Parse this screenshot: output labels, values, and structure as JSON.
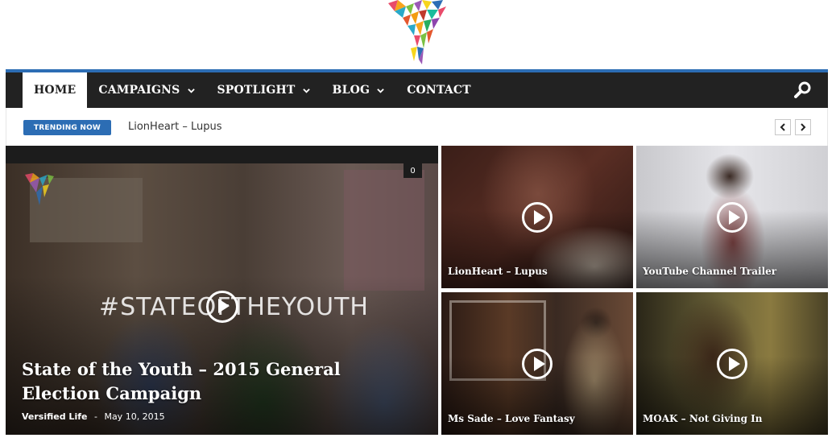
{
  "site": {
    "logo_icon": "versified-v-logo"
  },
  "nav": {
    "items": [
      {
        "label": "HOME",
        "active": true,
        "dropdown": false
      },
      {
        "label": "CAMPAIGNS",
        "active": false,
        "dropdown": true
      },
      {
        "label": "SPOTLIGHT",
        "active": false,
        "dropdown": true
      },
      {
        "label": "BLOG",
        "active": false,
        "dropdown": true
      },
      {
        "label": "CONTACT",
        "active": false,
        "dropdown": false
      }
    ],
    "search_icon": "search-icon",
    "accent_color": "#2c6db4",
    "bar_color": "#222222"
  },
  "trending": {
    "badge": "TRENDING NOW",
    "title": "LionHeart – Lupus"
  },
  "featured": {
    "title": "State of the Youth – 2015 General Election Campaign",
    "author": "Versified Life",
    "separator": "-",
    "date": "May 10, 2015",
    "comments": "0",
    "overlay_text": "#STATEOFTHEYOUTH"
  },
  "tiles": [
    {
      "title": "LionHeart – Lupus"
    },
    {
      "title": "YouTube Channel Trailer"
    },
    {
      "title": "Ms Sade – Love Fantasy"
    },
    {
      "title": "MOAK – Not Giving In"
    }
  ]
}
